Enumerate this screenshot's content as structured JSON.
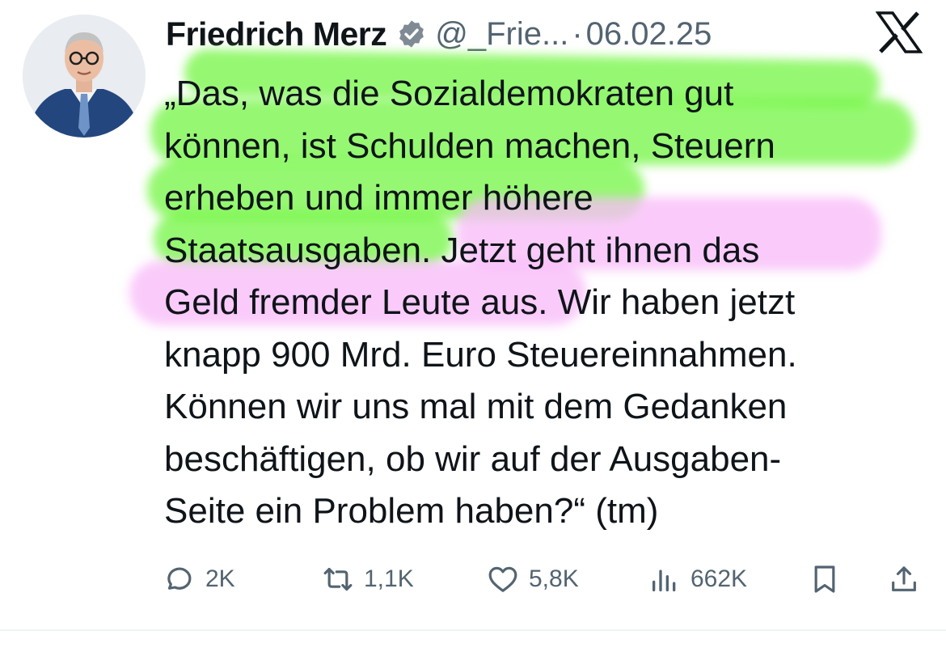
{
  "post": {
    "author_name": "Friedrich Merz",
    "handle": "@_Frie...",
    "separator": "·",
    "date": "06.02.25",
    "body_lines": [
      "„Das, was die Sozialdemokraten gut",
      "können, ist Schulden machen, Steuern",
      "erheben und immer höhere",
      "Staatsausgaben. Jetzt geht ihnen das",
      "Geld fremder Leute aus. Wir haben jetzt",
      "knapp 900 Mrd. Euro Steuereinnahmen.",
      "Können wir uns mal mit dem Gedanken",
      "beschäftigen, ob wir auf der Ausgaben-",
      "Seite ein Problem haben?“ (tm)"
    ]
  },
  "actions": {
    "replies": "2K",
    "reposts": "1,1K",
    "likes": "5,8K",
    "views": "662K"
  },
  "icons": {
    "verified": "verified-badge-icon",
    "x_logo": "x-logo-icon",
    "reply": "reply-icon",
    "repost": "repost-icon",
    "like": "heart-icon",
    "views": "views-icon",
    "bookmark": "bookmark-icon",
    "share": "share-icon"
  },
  "colors": {
    "text": "#0f1419",
    "muted": "#536471",
    "green_highlight": "#6ef53c",
    "pink_highlight": "#f8bcf8"
  }
}
